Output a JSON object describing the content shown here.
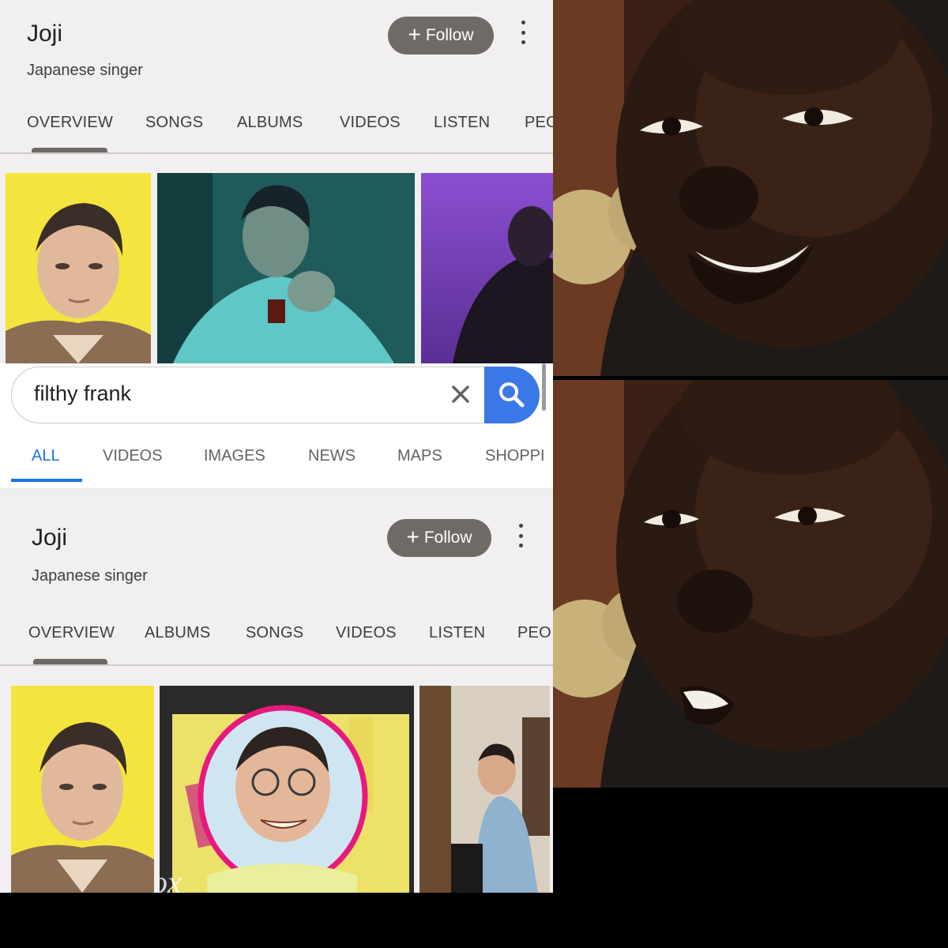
{
  "top_panel": {
    "name": "Joji",
    "subtitle": "Japanese singer",
    "follow_label": "Follow",
    "tabs": [
      "OVERVIEW",
      "SONGS",
      "ALBUMS",
      "VIDEOS",
      "LISTEN",
      "PEO"
    ]
  },
  "search": {
    "query": "filthy frank",
    "tabs": [
      "ALL",
      "VIDEOS",
      "IMAGES",
      "NEWS",
      "MAPS",
      "SHOPPI"
    ]
  },
  "bottom_panel": {
    "name": "Joji",
    "subtitle": "Japanese singer",
    "follow_label": "Follow",
    "tabs": [
      "OVERVIEW",
      "ALBUMS",
      "SONGS",
      "VIDEOS",
      "LISTEN",
      "PEO"
    ],
    "watermark": "ox"
  },
  "colors": {
    "follow_bg": "#6f6a66",
    "search_button": "#3b78e7",
    "active_tab": "#1a73e8",
    "circle_highlight": "#e8197d"
  },
  "icons": {
    "follow": "plus-icon",
    "more": "more-vertical-icon",
    "clear": "close-icon",
    "search": "search-icon"
  }
}
